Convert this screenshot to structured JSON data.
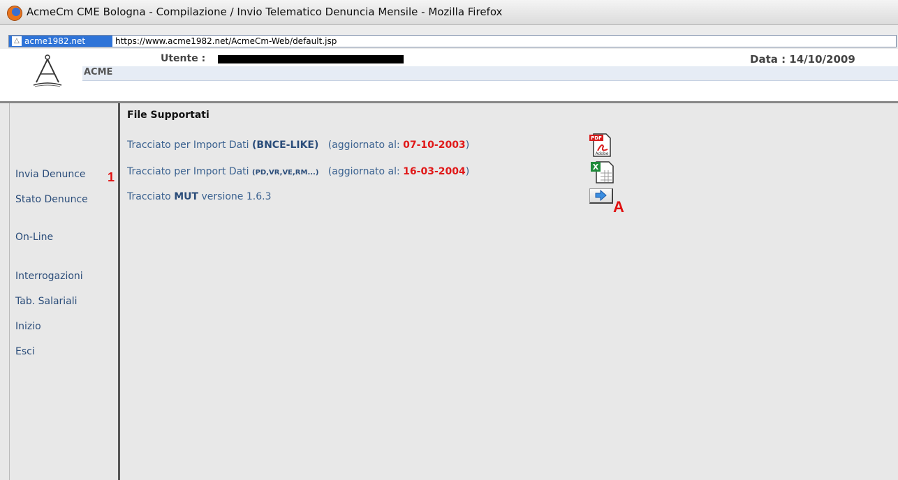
{
  "window": {
    "title": "AcmeCm CME Bologna - Compilazione / Invio Telematico Denuncia Mensile - Mozilla Firefox"
  },
  "urlbar": {
    "site": "acme1982.net",
    "url": "https://www.acme1982.net/AcmeCm-Web/default.jsp"
  },
  "header": {
    "brand": "ACME",
    "user_label": "Utente :",
    "user_value": "",
    "date_label": "Data : 14/10/2009"
  },
  "sidebar": {
    "items": [
      {
        "label": "Invia Denunce"
      },
      {
        "label": "Stato Denunce"
      },
      {
        "label": "On-Line"
      },
      {
        "label": "Interrogazioni"
      },
      {
        "label": "Tab. Salariali"
      },
      {
        "label": "Inizio"
      },
      {
        "label": "Esci"
      }
    ],
    "marker": "1"
  },
  "content": {
    "title": "File Supportati",
    "rows": [
      {
        "prefix": "Tracciato per Import Dati ",
        "format": "(BNCE-LIKE)",
        "updated_label": "(aggiornato al: ",
        "date": "07-10-2003",
        "close": ")",
        "icon": "pdf-icon"
      },
      {
        "prefix": "Tracciato per Import Dati ",
        "format": "(PD,VR,VE,RM...)",
        "updated_label": "(aggiornato al: ",
        "date": "16-03-2004",
        "close": ")",
        "icon": "excel-icon"
      },
      {
        "prefix": "Tracciato ",
        "format": "MUT",
        "suffix": " versione 1.6.3",
        "icon": "arrow-right-icon"
      }
    ],
    "marker": "A"
  },
  "colors": {
    "accent_blue": "#2f74d8",
    "link_blue": "#3b6290",
    "date_red": "#e01818",
    "marker_red": "#e01010"
  }
}
